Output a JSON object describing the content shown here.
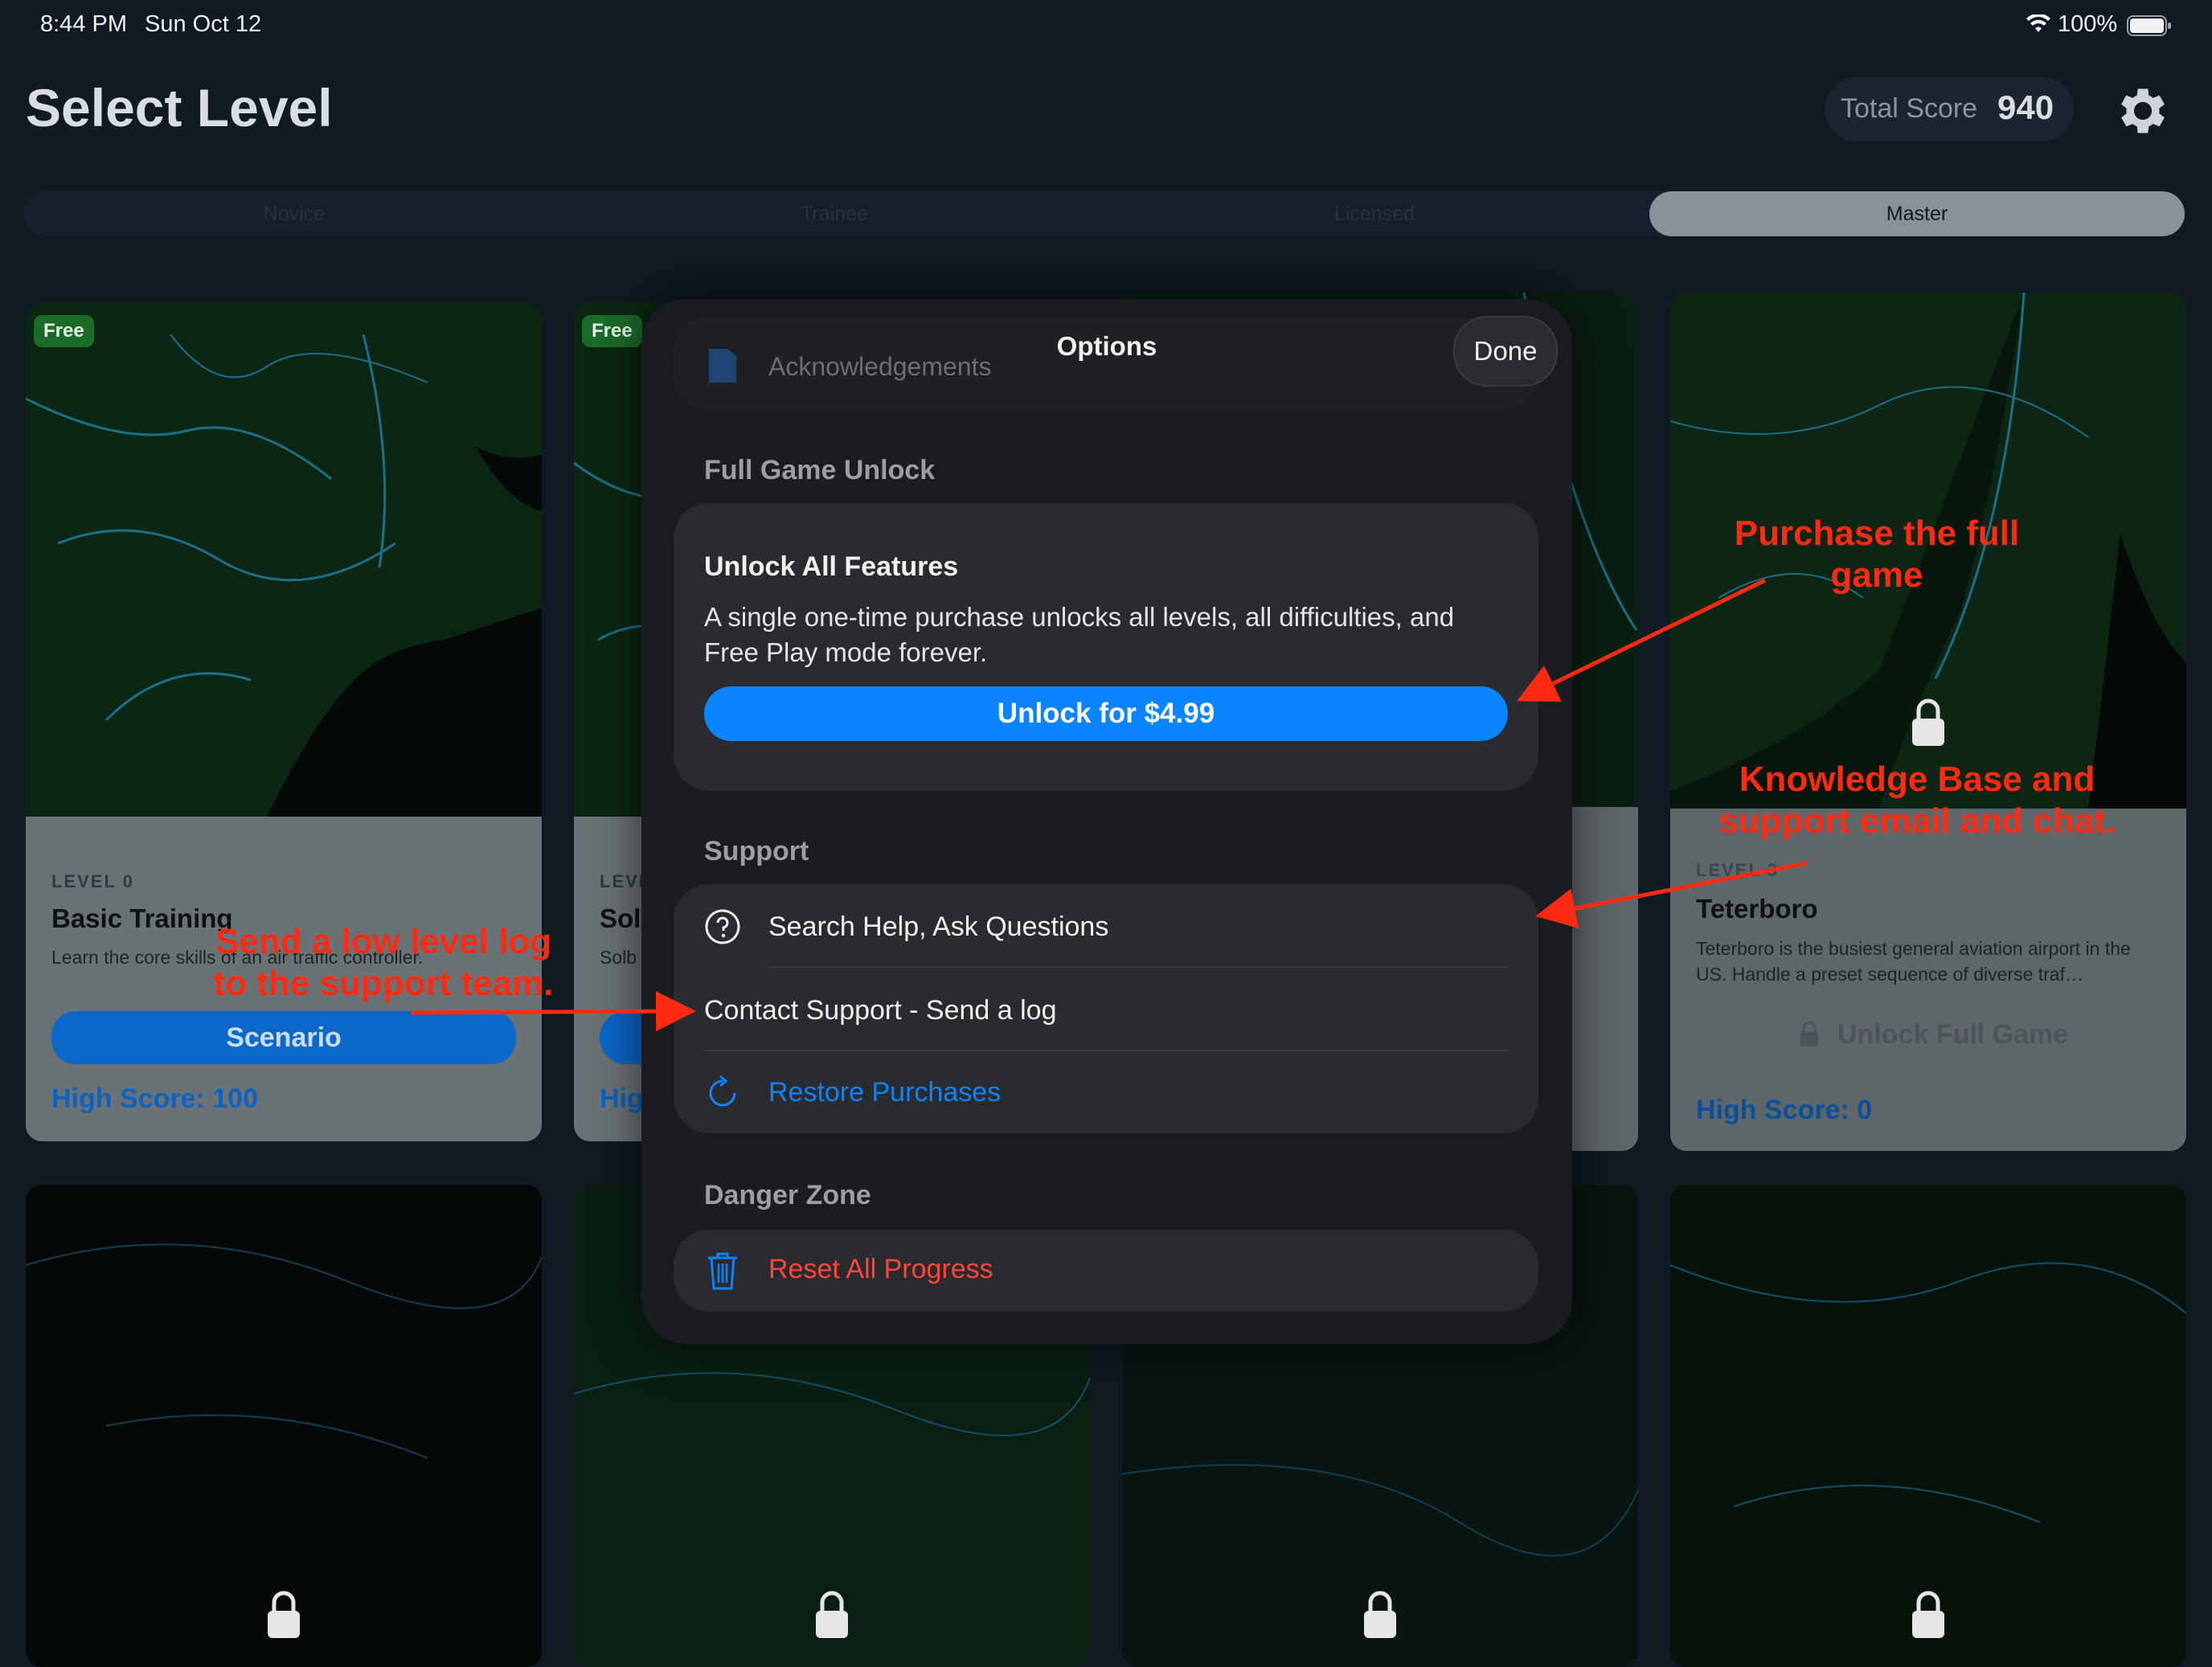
{
  "status_bar": {
    "time": "8:44 PM",
    "date": "Sun Oct 12",
    "battery": "100%"
  },
  "header": {
    "title": "Select Level",
    "total_score_label": "Total Score",
    "total_score_value": "940",
    "settings_icon": "gear-icon"
  },
  "tabs": [
    {
      "label": "Novice"
    },
    {
      "label": "Trainee"
    },
    {
      "label": "Licensed"
    },
    {
      "label": "Master",
      "selected": true
    }
  ],
  "cards": [
    {
      "badge": "Free",
      "level": "LEVEL 0",
      "name": "Basic Training",
      "desc": "Learn the core skills of an air traffic controller.",
      "button": "Scenario",
      "high_score": "High Score: 100"
    },
    {
      "badge": "Free",
      "level": "LEVE",
      "name": "Sol",
      "desc": "Solb",
      "button": "",
      "high_score": "Hig"
    },
    {
      "level": "LEVEL 3",
      "name": "Teterboro",
      "desc": "Teterboro is the busiest general aviation airport in the US. Handle a preset sequence of diverse traf…",
      "button": "Unlock Full Game",
      "high_score": "High Score: 0"
    }
  ],
  "modal": {
    "title": "Options",
    "done": "Done",
    "ack_row": "Acknowledgements",
    "full_game_header": "Full Game Unlock",
    "unlock_title": "Unlock All Features",
    "unlock_desc": "A single one-time purchase unlocks all levels, all difficulties, and Free Play mode forever.",
    "unlock_button": "Unlock for $4.99",
    "support_header": "Support",
    "support_rows": [
      {
        "label": "Search Help, Ask Questions",
        "icon": "question-circle-icon"
      },
      {
        "label": "Contact Support - Send a log"
      },
      {
        "label": "Restore Purchases",
        "icon": "refresh-icon"
      }
    ],
    "danger_header": "Danger Zone",
    "reset": "Reset All Progress",
    "reset_icon": "trash-icon"
  },
  "annotations": {
    "purchase": "Purchase the full game",
    "knowledge": "Knowledge Base and support email and chat.",
    "log": "Send a low level log to the support team."
  },
  "colors": {
    "accent": "#0a84ff",
    "danger": "#ff453a",
    "annotation": "#ff2a12",
    "free_badge": "#1b6b2a"
  }
}
